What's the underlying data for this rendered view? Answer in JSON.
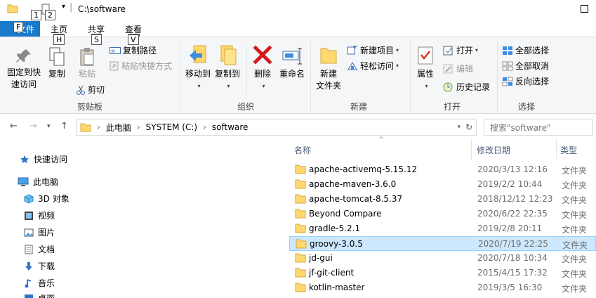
{
  "title": "C:\\software",
  "key_tips": {
    "qat1": "1",
    "qat2": "2",
    "file": "F",
    "home": "H",
    "share": "S",
    "view": "V"
  },
  "tabs": {
    "file": "文件",
    "home": "主页",
    "share": "共享",
    "view": "查看"
  },
  "ribbon": {
    "clipboard": {
      "label": "剪贴板",
      "pin": "固定到快\n速访问",
      "copy": "复制",
      "paste": "粘贴",
      "copy_path": "复制路径",
      "paste_shortcut": "粘贴快捷方式",
      "cut": "剪切"
    },
    "organize": {
      "label": "组织",
      "move_to": "移动到",
      "copy_to": "复制到",
      "delete": "删除",
      "rename": "重命名"
    },
    "new": {
      "label": "新建",
      "new_folder": "新建\n文件夹",
      "new_item": "新建项目",
      "easy_access": "轻松访问"
    },
    "open": {
      "label": "打开",
      "properties": "属性",
      "open": "打开",
      "edit": "编辑",
      "history": "历史记录"
    },
    "select": {
      "label": "选择",
      "select_all": "全部选择",
      "select_none": "全部取消",
      "invert": "反向选择"
    }
  },
  "address": {
    "crumbs": [
      "此电脑",
      "SYSTEM (C:)",
      "software"
    ],
    "search_placeholder": "搜索\"software\""
  },
  "nav_pane": [
    {
      "label": "快速访问",
      "icon": "star-icon"
    },
    {
      "label": "此电脑",
      "icon": "computer-icon"
    },
    {
      "label": "3D 对象",
      "icon": "cube-icon"
    },
    {
      "label": "视频",
      "icon": "video-icon"
    },
    {
      "label": "图片",
      "icon": "picture-icon"
    },
    {
      "label": "文档",
      "icon": "document-icon"
    },
    {
      "label": "下载",
      "icon": "download-icon"
    },
    {
      "label": "音乐",
      "icon": "music-icon"
    },
    {
      "label": "桌面",
      "icon": "desktop-icon"
    }
  ],
  "columns": {
    "name": "名称",
    "date": "修改日期",
    "type": "类型"
  },
  "files": [
    {
      "name": "apache-activemq-5.15.12",
      "date": "2020/3/13 12:16",
      "type": "文件夹"
    },
    {
      "name": "apache-maven-3.6.0",
      "date": "2019/2/2 10:44",
      "type": "文件夹"
    },
    {
      "name": "apache-tomcat-8.5.37",
      "date": "2018/12/12 12:23",
      "type": "文件夹"
    },
    {
      "name": "Beyond Compare",
      "date": "2020/6/22 22:35",
      "type": "文件夹"
    },
    {
      "name": "gradle-5.2.1",
      "date": "2019/2/8 20:11",
      "type": "文件夹"
    },
    {
      "name": "groovy-3.0.5",
      "date": "2020/7/19 22:25",
      "type": "文件夹",
      "selected": true
    },
    {
      "name": "jd-gui",
      "date": "2020/7/18 10:34",
      "type": "文件夹"
    },
    {
      "name": "jf-git-client",
      "date": "2015/4/15 17:32",
      "type": "文件夹"
    },
    {
      "name": "kotlin-master",
      "date": "2019/3/5 16:30",
      "type": "文件夹"
    }
  ],
  "colors": {
    "accent": "#1979ca",
    "selected_bg": "#cce8ff",
    "folder": "#ffd86e"
  }
}
